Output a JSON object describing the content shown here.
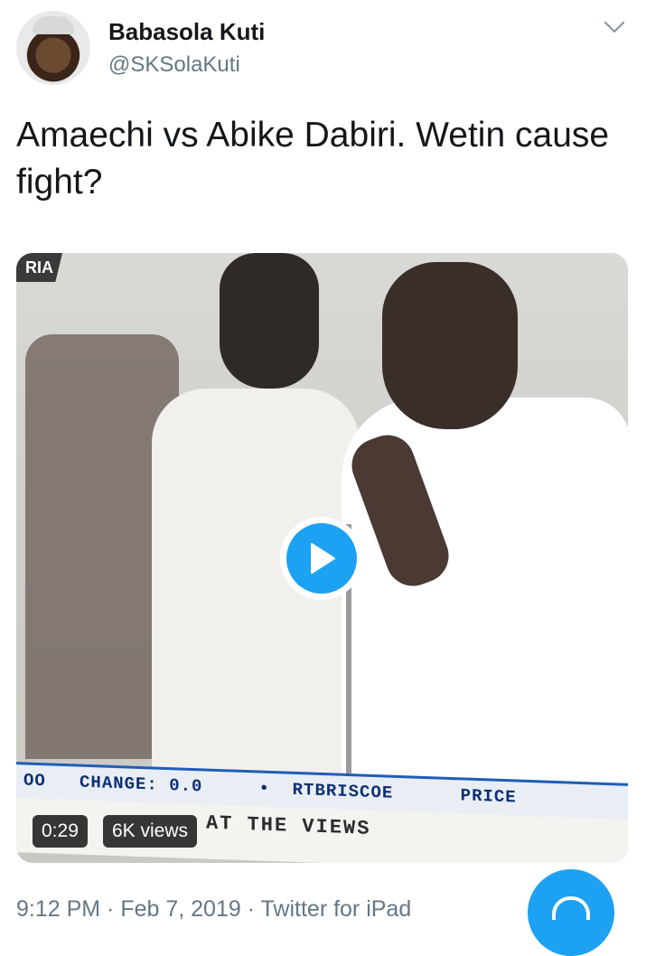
{
  "author": {
    "name": "Babasola Kuti",
    "handle": "@SKSolaKuti"
  },
  "tweet": {
    "text": "Amaechi vs Abike Dabiri. Wetin cause fight?"
  },
  "media": {
    "corner_label": "RIA",
    "ticker_line1": "OO   CHANGE: 0.0     •  RTBRISCOE      PRICE",
    "ticker_line2": "AT THE VIEWS",
    "duration": "0:29",
    "views": "6K views"
  },
  "meta": {
    "timestamp": "9:12 PM · Feb 7, 2019 · Twitter for iPad"
  },
  "icons": {
    "more": "chevron-down-icon",
    "play": "play-icon",
    "fab": "compose-icon"
  },
  "colors": {
    "accent": "#1da1f2",
    "secondary_text": "#657786",
    "primary_text": "#14171a"
  }
}
